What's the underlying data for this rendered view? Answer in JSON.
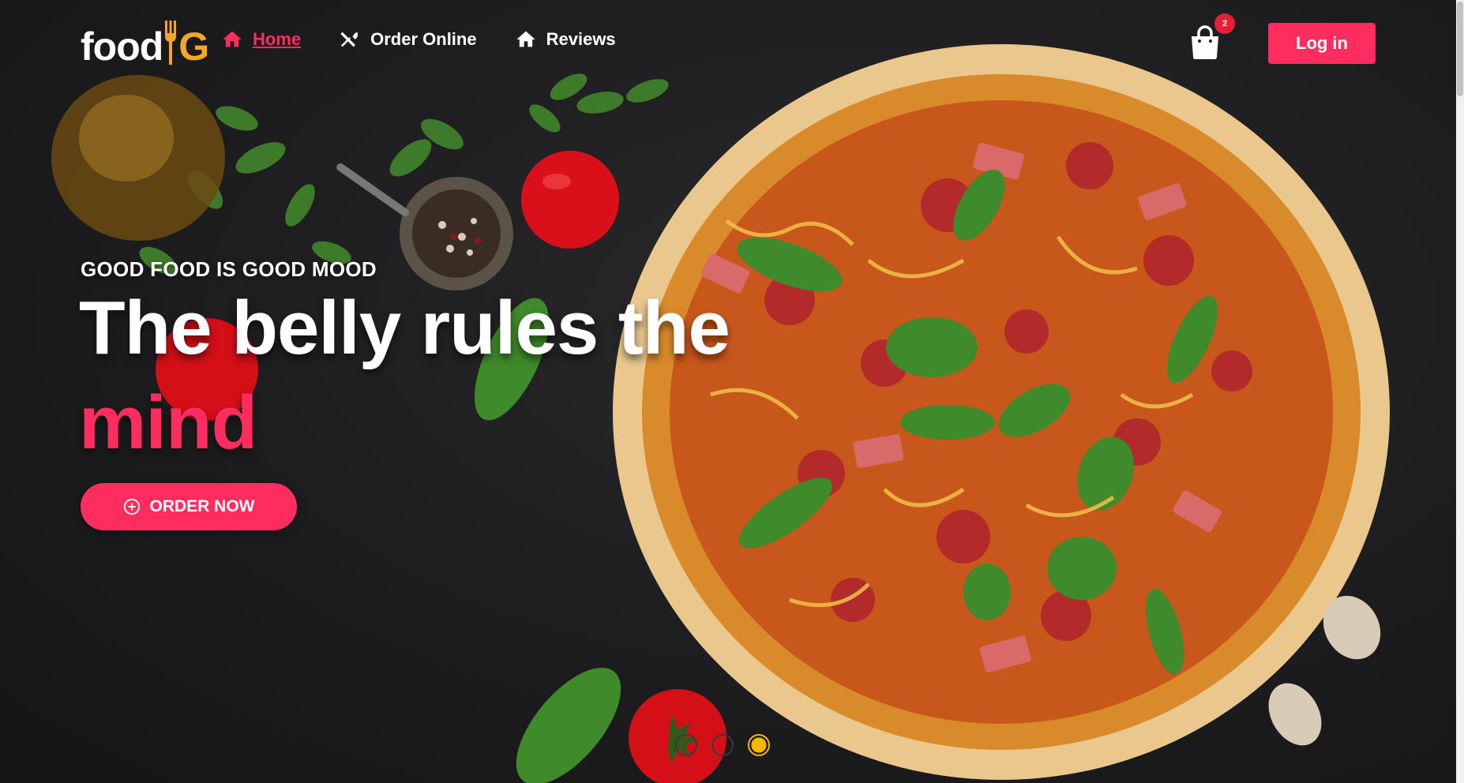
{
  "brand": {
    "logo_part1": "food",
    "logo_part2": "G"
  },
  "nav": {
    "items": [
      {
        "label": "Home",
        "icon": "home-icon",
        "active": true
      },
      {
        "label": "Order Online",
        "icon": "utensils-icon",
        "active": false
      },
      {
        "label": "Reviews",
        "icon": "home-icon",
        "active": false
      }
    ]
  },
  "cart": {
    "icon": "shopping-bag-icon",
    "count": "2"
  },
  "header": {
    "login_label": "Log in"
  },
  "hero": {
    "tagline": "GOOD FOOD IS GOOD MOOD",
    "headline_main": "The belly rules the",
    "headline_accent": "mind",
    "cta_label": "ORDER NOW",
    "cta_icon": "plus-circle-icon"
  },
  "carousel": {
    "slide_count": 3,
    "active_index": 2
  },
  "colors": {
    "accent": "#ff2d5f",
    "logo_accent": "#f5a623",
    "dot_active": "#f5b700",
    "badge": "#e51f35",
    "background": "#1d1d1f"
  }
}
